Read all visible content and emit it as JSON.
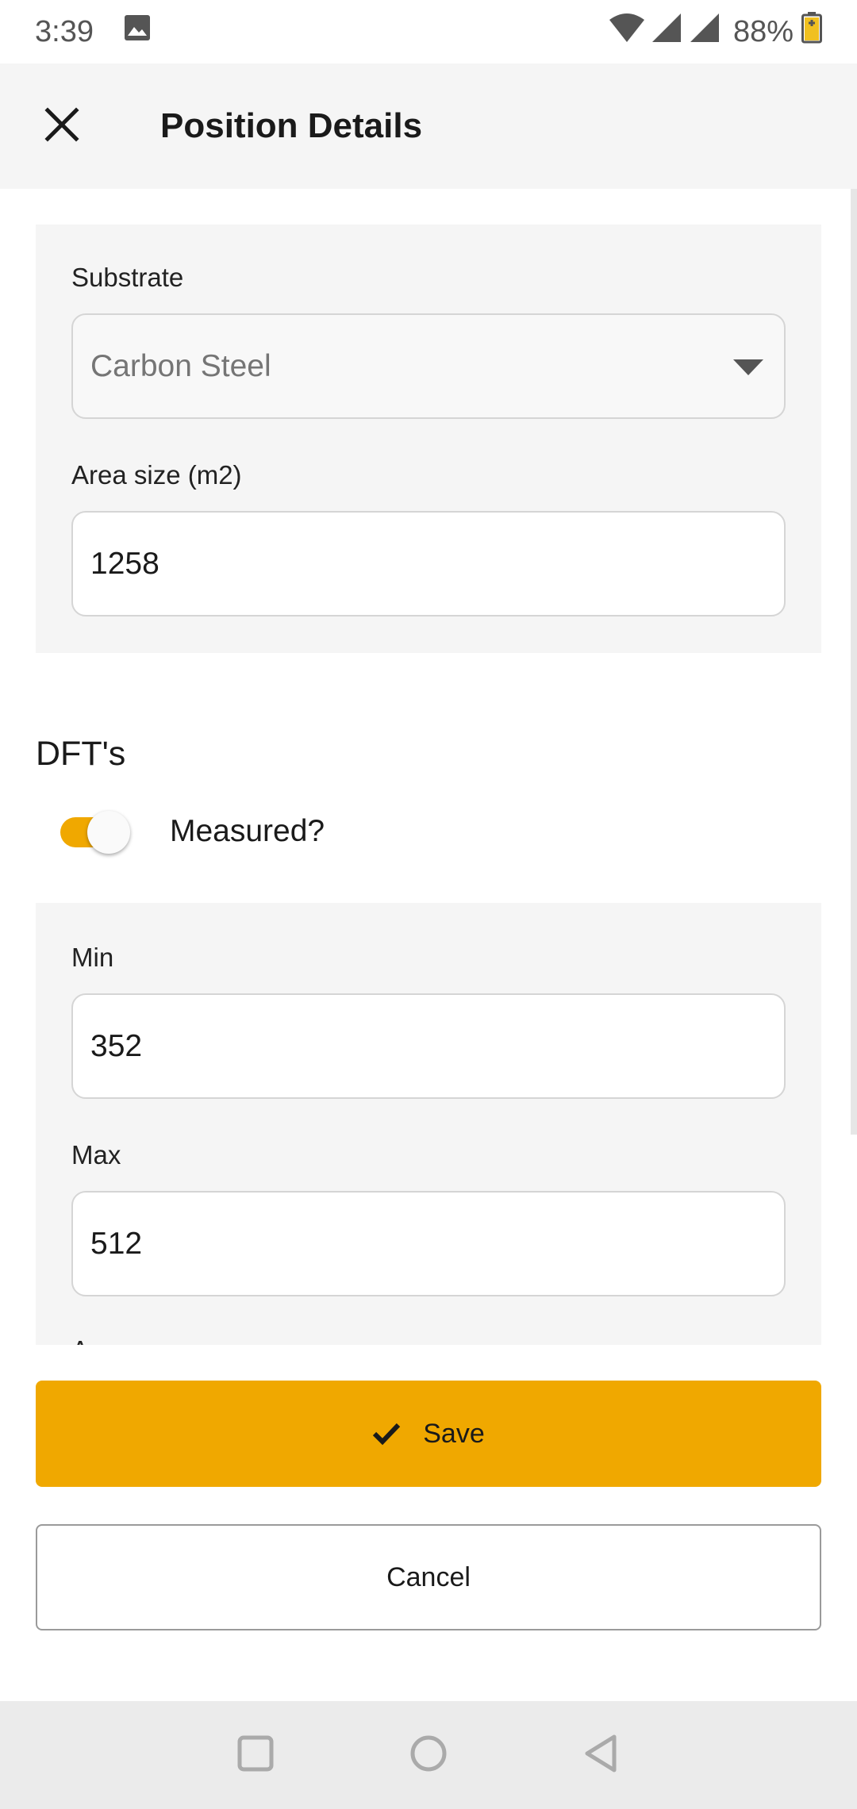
{
  "status_bar": {
    "time": "3:39",
    "battery_percent": "88%",
    "icons": [
      "image-icon",
      "wifi-icon",
      "signal-icon",
      "signal-icon",
      "battery-charging-icon"
    ]
  },
  "app_bar": {
    "title": "Position Details",
    "close_icon": "close-icon"
  },
  "form": {
    "substrate": {
      "label": "Substrate",
      "value": "Carbon Steel"
    },
    "area_size": {
      "label": "Area size (m2)",
      "value": "1258"
    },
    "dfts": {
      "title": "DFT's",
      "measured_label": "Measured?",
      "measured_on": true,
      "min_label": "Min",
      "min_value": "352",
      "max_label": "Max",
      "max_value": "512",
      "next_label_partial": "A"
    }
  },
  "actions": {
    "save_label": "Save",
    "cancel_label": "Cancel"
  },
  "colors": {
    "accent": "#f0a800",
    "panel_bg": "#f5f5f5",
    "app_bar_bg": "#f5f5f5",
    "nav_bar_bg": "#ebebeb"
  }
}
